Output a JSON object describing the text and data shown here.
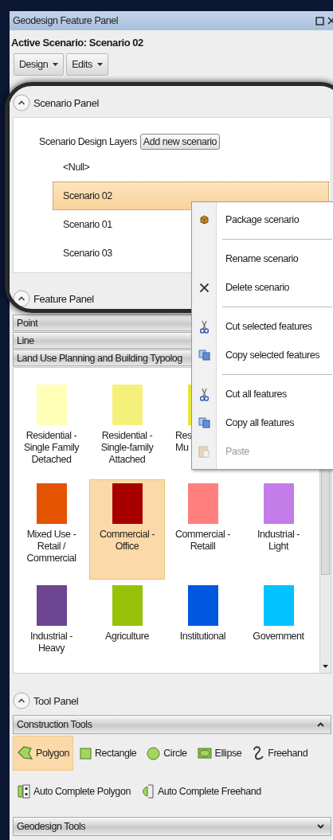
{
  "window": {
    "title": "Geodesign Feature Panel"
  },
  "active_scenario": "Active Scenario: Scenario 02",
  "toolbar": [
    {
      "label": "Design"
    },
    {
      "label": "Edits"
    }
  ],
  "scenario_panel": {
    "title": "Scenario Panel",
    "expanded": true,
    "layers_label": "Scenario Design Layers",
    "add_button": "Add new scenario",
    "items": [
      {
        "label": "<Null>",
        "selected": false
      },
      {
        "label": "Scenario 02",
        "selected": true
      },
      {
        "label": "Scenario 01",
        "selected": false
      },
      {
        "label": "Scenario 03",
        "selected": false
      }
    ]
  },
  "feature_panel": {
    "title": "Feature Panel",
    "expanded": true,
    "groups": [
      {
        "label": "Point"
      },
      {
        "label": "Line"
      },
      {
        "label": "Land Use Planning and Building Typolog"
      }
    ],
    "tile_rows": [
      [
        {
          "kind": "full",
          "lines": [
            "Residential -",
            "Single Family",
            "Detached"
          ],
          "color": "#ffffb8",
          "selected": false
        },
        {
          "kind": "full",
          "lines": [
            "Residential -",
            "Single-family",
            "Attached"
          ],
          "color": "#f5f07a",
          "selected": false
        },
        {
          "kind": "partial",
          "lines": [
            "Res",
            "Mu"
          ],
          "color": "#e8e43a",
          "selected": false
        }
      ],
      [
        {
          "kind": "full",
          "lines": [
            "Mixed Use -",
            "Retail /",
            "Commercial"
          ],
          "color": "#e45300",
          "selected": false
        },
        {
          "kind": "full",
          "lines": [
            "Commercial -",
            "Office"
          ],
          "color": "#a80000",
          "selected": true
        },
        {
          "kind": "full",
          "lines": [
            "Commercial -",
            "Retaill"
          ],
          "color": "#ff7f7f",
          "selected": false
        },
        {
          "kind": "full",
          "lines": [
            "Industrial -",
            "Light"
          ],
          "color": "#c47de8",
          "selected": false
        }
      ],
      [
        {
          "kind": "full",
          "lines": [
            "Industrial -",
            "Heavy"
          ],
          "color": "#6e4590",
          "selected": false
        },
        {
          "kind": "full",
          "lines": [
            "Agriculture"
          ],
          "color": "#98c20a",
          "selected": false
        },
        {
          "kind": "full",
          "lines": [
            "Institutional"
          ],
          "color": "#0058e0",
          "selected": false
        },
        {
          "kind": "full",
          "lines": [
            "Government"
          ],
          "color": "#00c3ff",
          "selected": false
        }
      ]
    ]
  },
  "context_menu": [
    {
      "kind": "package",
      "label": "Package scenario",
      "disabled": false
    },
    {
      "kind": "separator"
    },
    {
      "kind": "plain",
      "label": "Rename scenario",
      "disabled": false
    },
    {
      "kind": "delete",
      "label": "Delete scenario",
      "disabled": false
    },
    {
      "kind": "separator"
    },
    {
      "kind": "cut",
      "label": "Cut selected features",
      "disabled": false
    },
    {
      "kind": "copy",
      "label": "Copy selected features",
      "disabled": false
    },
    {
      "kind": "separator"
    },
    {
      "kind": "cut",
      "label": "Cut all features",
      "disabled": false
    },
    {
      "kind": "copy",
      "label": "Copy all features",
      "disabled": false
    },
    {
      "kind": "paste",
      "label": "Paste",
      "disabled": true
    }
  ],
  "tool_panel": {
    "title": "Tool Panel",
    "expanded": true,
    "sections": [
      {
        "label": "Construction Tools",
        "expanded": true,
        "tools": [
          {
            "kind": "polygon",
            "label": "Polygon",
            "selected": true
          },
          {
            "kind": "rectangle",
            "label": "Rectangle",
            "selected": false
          },
          {
            "kind": "circle",
            "label": "Circle",
            "selected": false
          },
          {
            "kind": "ellipse",
            "label": "Ellipse",
            "selected": false
          },
          {
            "kind": "freehand",
            "label": "Freehand",
            "selected": false
          },
          {
            "kind": "autopolygon",
            "label": "Auto Complete Polygon",
            "selected": false
          },
          {
            "kind": "autofreehand",
            "label": "Auto Complete Freehand",
            "selected": false
          }
        ]
      },
      {
        "label": "Geodesign Tools",
        "expanded": false
      }
    ]
  }
}
